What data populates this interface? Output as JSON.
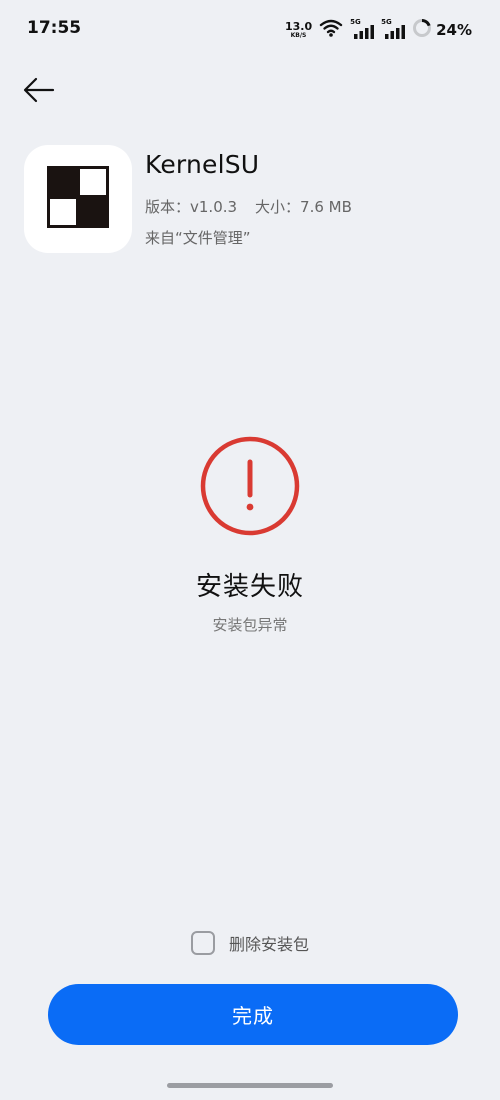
{
  "status_bar": {
    "time": "17:55",
    "net_speed_value": "13.0",
    "net_speed_unit": "KB/S",
    "sim1_tag": "5G",
    "sim2_tag": "5G",
    "battery_percent": "24%"
  },
  "header": {
    "back_icon": "arrow-left-icon"
  },
  "app": {
    "name": "KernelSU",
    "version": "版本：v1.0.3",
    "size": "大小：7.6 MB",
    "source": "来自“文件管理”",
    "icon": "checkerboard-logo"
  },
  "result": {
    "icon": "exclamation-circle-icon",
    "title": "安装失败",
    "subtitle": "安装包异常",
    "error_color": "#d93a32"
  },
  "footer": {
    "delete_package_label": "删除安装包",
    "delete_package_checked": false,
    "done_label": "完成",
    "accent_color": "#0a6cf6"
  }
}
